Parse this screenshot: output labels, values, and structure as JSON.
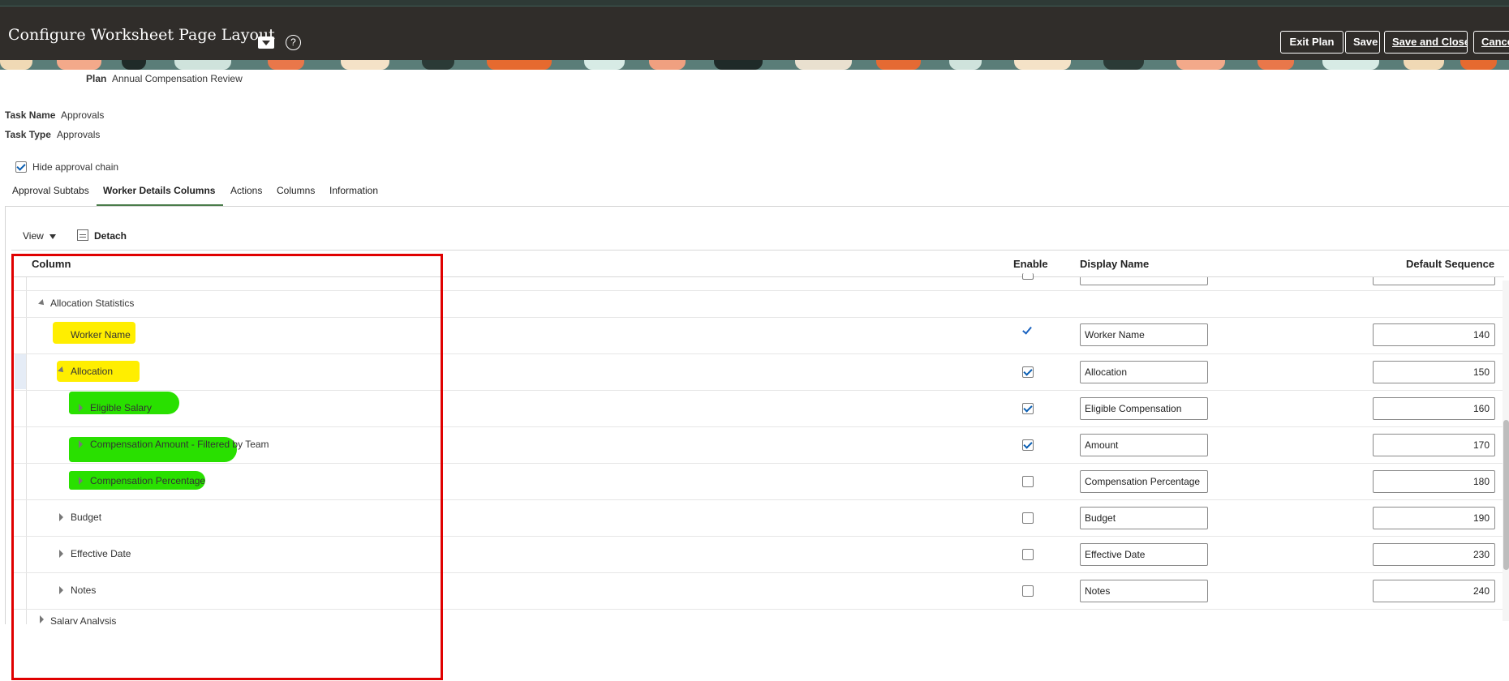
{
  "header": {
    "title": "Configure Worksheet Page Layout",
    "help_glyph": "?",
    "buttons": {
      "exit_plan": "Exit Plan",
      "save": "Save",
      "save_and_close": "Save and Close",
      "cancel": "Cancel"
    }
  },
  "info": {
    "plan_label": "Plan",
    "plan_value": "Annual Compensation Review",
    "task_name_label": "Task Name",
    "task_name_value": "Approvals",
    "task_type_label": "Task Type",
    "task_type_value": "Approvals"
  },
  "hide_approval_chain": {
    "label": "Hide approval chain",
    "checked": true
  },
  "tabs": [
    {
      "label": "Approval Subtabs",
      "active": false
    },
    {
      "label": "Worker Details Columns",
      "active": true
    },
    {
      "label": "Actions",
      "active": false
    },
    {
      "label": "Columns",
      "active": false
    },
    {
      "label": "Information",
      "active": false
    }
  ],
  "toolbar": {
    "view_label": "View",
    "detach_label": "Detach"
  },
  "table": {
    "headers": {
      "column": "Column",
      "enable": "Enable",
      "display_name": "Display Name",
      "default_sequence": "Default Sequence"
    },
    "rows": [
      {
        "label": "Allocation Statistics",
        "enable": null,
        "display_name": null,
        "sequence": null
      },
      {
        "label": "Worker Name",
        "enable": true,
        "display_name": "Worker Name",
        "sequence": "140"
      },
      {
        "label": "Allocation",
        "enable": true,
        "display_name": "Allocation",
        "sequence": "150"
      },
      {
        "label": "Eligible Salary",
        "enable": true,
        "display_name": "Eligible Compensation",
        "sequence": "160"
      },
      {
        "label": "Compensation Amount - Filtered by Team",
        "enable": true,
        "display_name": "Amount",
        "sequence": "170"
      },
      {
        "label": "Compensation Percentage",
        "enable": false,
        "display_name": "Compensation Percentage",
        "sequence": "180"
      },
      {
        "label": "Budget",
        "enable": false,
        "display_name": "Budget",
        "sequence": "190"
      },
      {
        "label": "Effective Date",
        "enable": false,
        "display_name": "Effective Date",
        "sequence": "230"
      },
      {
        "label": "Notes",
        "enable": false,
        "display_name": "Notes",
        "sequence": "240"
      },
      {
        "label": "Salary Analysis",
        "enable": null,
        "display_name": null,
        "sequence": null
      }
    ]
  },
  "colors": {
    "header_bg": "#302d2a",
    "highlight_yellow": "#ffee00",
    "highlight_green": "#29e000",
    "annotation_red": "#e00000",
    "active_tab_underline": "#4a7c4a"
  }
}
